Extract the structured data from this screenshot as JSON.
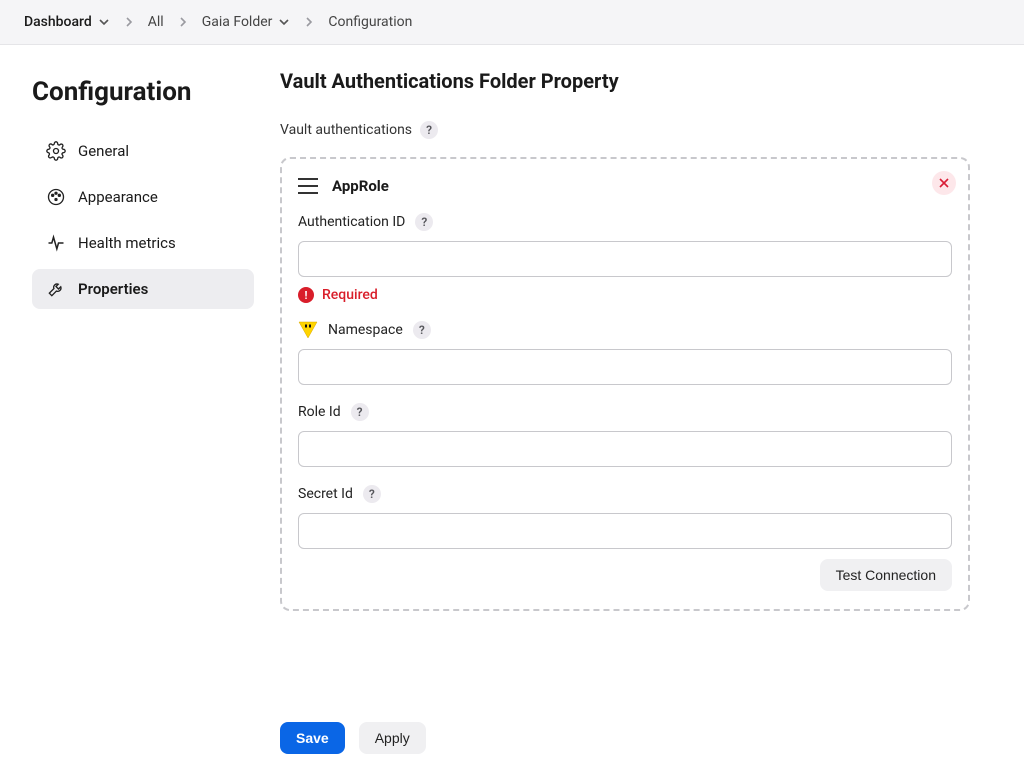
{
  "breadcrumbs": {
    "dashboard": "Dashboard",
    "all": "All",
    "folder": "Gaia Folder",
    "page": "Configuration"
  },
  "sidebar": {
    "title": "Configuration",
    "items": [
      {
        "label": "General"
      },
      {
        "label": "Appearance"
      },
      {
        "label": "Health metrics"
      },
      {
        "label": "Properties"
      }
    ],
    "active_index": 3
  },
  "page": {
    "title": "Vault Authentications Folder Property",
    "section_label": "Vault authentications"
  },
  "card": {
    "title": "AppRole",
    "fields": {
      "auth_id": {
        "label": "Authentication ID",
        "value": "",
        "error": "Required"
      },
      "namespace": {
        "label": "Namespace",
        "value": ""
      },
      "role_id": {
        "label": "Role Id",
        "value": ""
      },
      "secret_id": {
        "label": "Secret Id",
        "value": ""
      }
    },
    "test_button": "Test Connection"
  },
  "actions": {
    "save": "Save",
    "apply": "Apply"
  }
}
